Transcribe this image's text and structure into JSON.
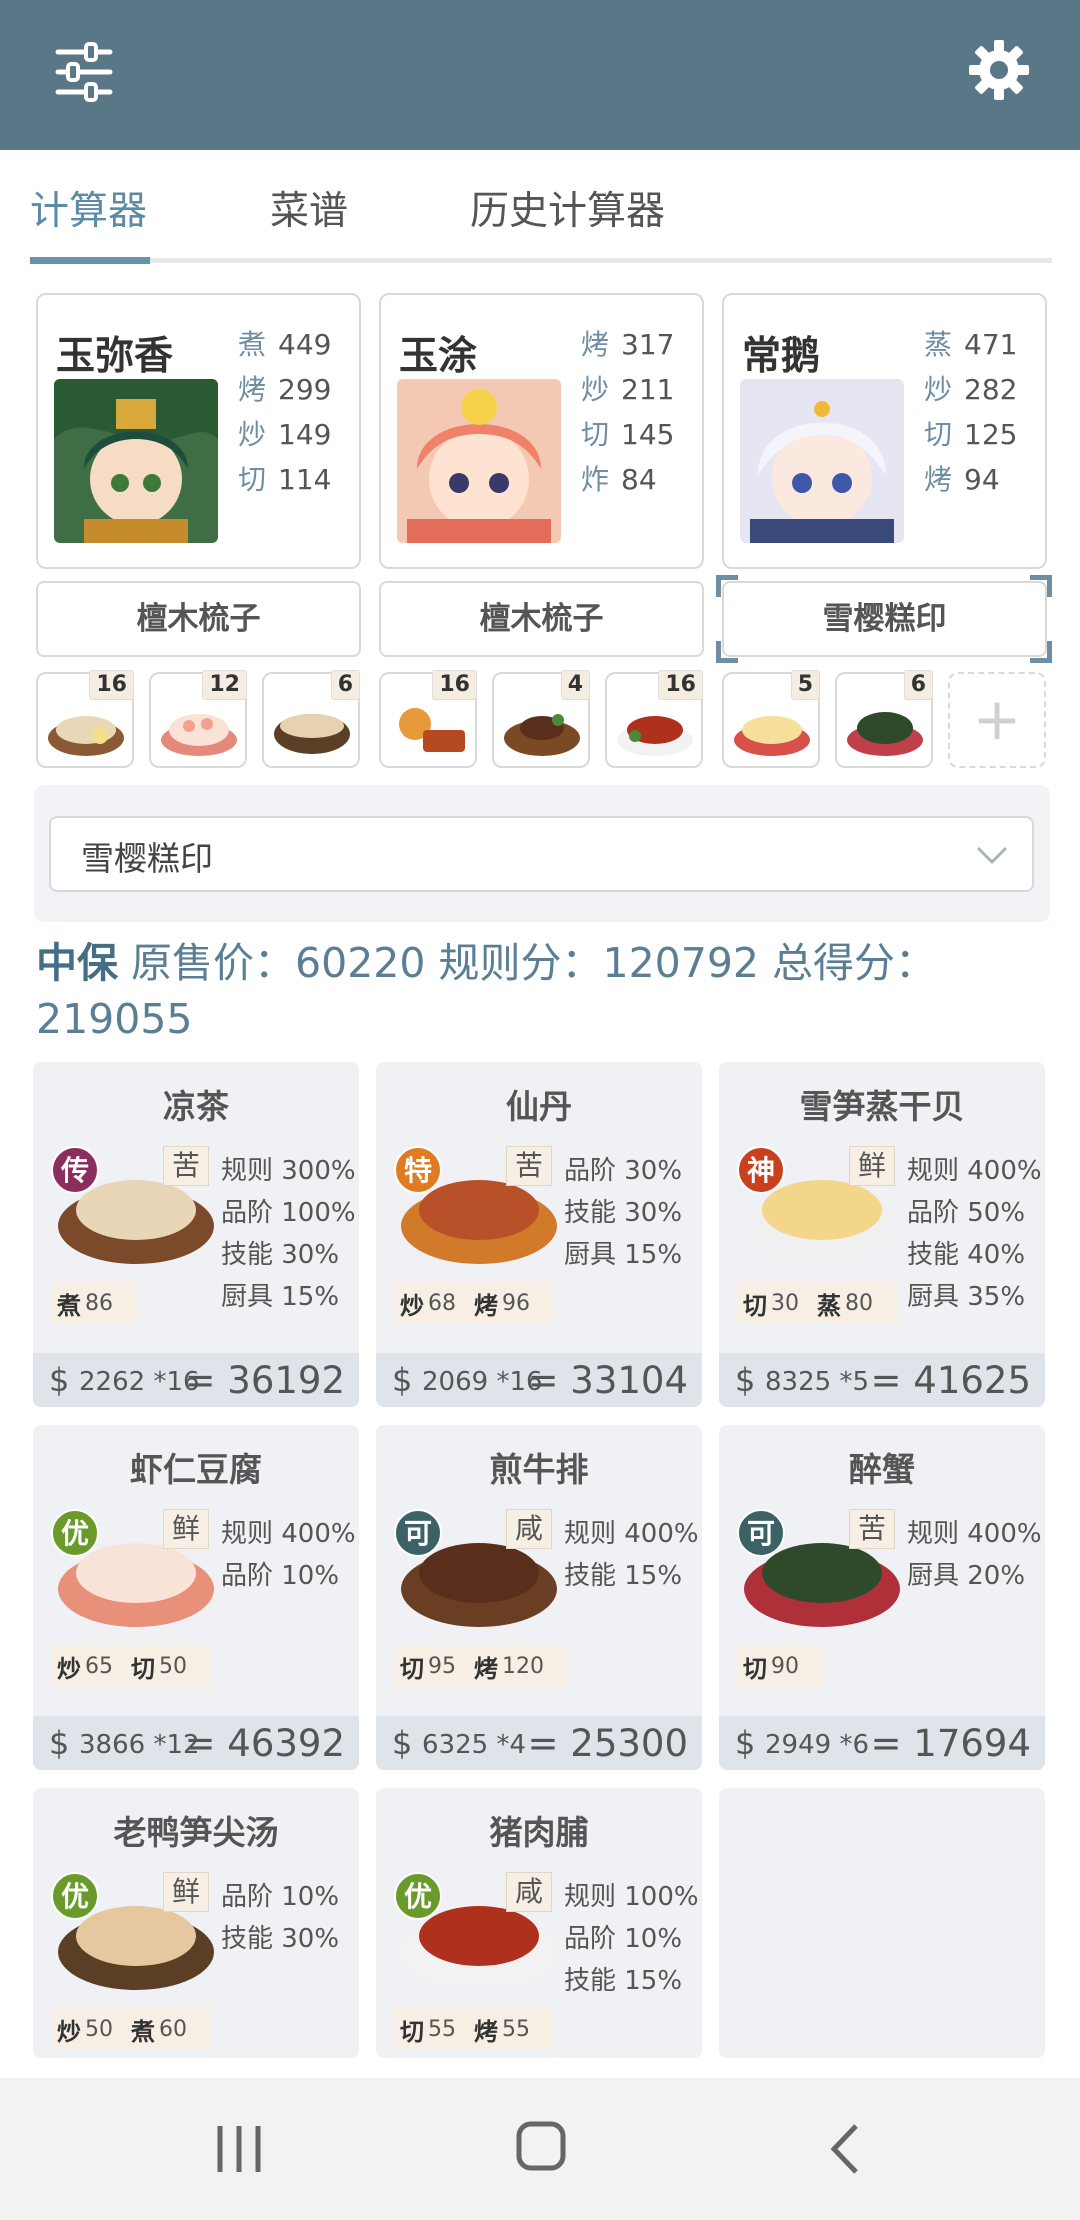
{
  "tabs": [
    "计算器",
    "菜谱",
    "历史计算器"
  ],
  "chefs": [
    {
      "name": "玉弥香",
      "stats": [
        {
          "k": "煮",
          "v": "449"
        },
        {
          "k": "烤",
          "v": "299"
        },
        {
          "k": "炒",
          "v": "149"
        },
        {
          "k": "切",
          "v": "114"
        }
      ],
      "equip": "檀木梳子"
    },
    {
      "name": "玉涂",
      "stats": [
        {
          "k": "烤",
          "v": "317"
        },
        {
          "k": "炒",
          "v": "211"
        },
        {
          "k": "切",
          "v": "145"
        },
        {
          "k": "炸",
          "v": "84"
        }
      ],
      "equip": "檀木梳子"
    },
    {
      "name": "常鹅",
      "stats": [
        {
          "k": "蒸",
          "v": "471"
        },
        {
          "k": "炒",
          "v": "282"
        },
        {
          "k": "切",
          "v": "125"
        },
        {
          "k": "烤",
          "v": "94"
        }
      ],
      "equip": "雪樱糕印"
    }
  ],
  "slots": [
    "16",
    "12",
    "6",
    "16",
    "4",
    "16",
    "5",
    "6"
  ],
  "add_slot": "+",
  "select_value": "雪樱糕印",
  "summary": {
    "tag": "中保",
    "text": " 原售价：60220 规则分：120792 总得分：219055"
  },
  "dishes": [
    {
      "title": "凉茶",
      "grade": "传",
      "grade_color": "#8b2d5e",
      "taste": "苦",
      "skills": [
        {
          "k": "煮",
          "v": "86"
        }
      ],
      "bonus": [
        "规则 300%",
        "品阶 100%",
        "技能 30%",
        "厨具 15%"
      ],
      "price": "2262",
      "mult": "*16",
      "result": "= 36192"
    },
    {
      "title": "仙丹",
      "grade": "特",
      "grade_color": "#e07b1f",
      "taste": "苦",
      "skills": [
        {
          "k": "炒",
          "v": "68"
        },
        {
          "k": "烤",
          "v": "96"
        }
      ],
      "bonus": [
        "品阶 30%",
        "技能 30%",
        "厨具 15%"
      ],
      "price": "2069",
      "mult": "*16",
      "result": "= 33104"
    },
    {
      "title": "雪笋蒸干贝",
      "grade": "神",
      "grade_color": "#c8401e",
      "taste": "鲜",
      "skills": [
        {
          "k": "切",
          "v": "30"
        },
        {
          "k": "蒸",
          "v": "80"
        }
      ],
      "bonus": [
        "规则 400%",
        "品阶 50%",
        "技能 40%",
        "厨具 35%"
      ],
      "price": "8325",
      "mult": "*5",
      "result": "= 41625"
    },
    {
      "title": "虾仁豆腐",
      "grade": "优",
      "grade_color": "#6a9a2a",
      "taste": "鲜",
      "skills": [
        {
          "k": "炒",
          "v": "65"
        },
        {
          "k": "切",
          "v": "50"
        }
      ],
      "bonus": [
        "规则 400%",
        "品阶 10%"
      ],
      "price": "3866",
      "mult": "*12",
      "result": "= 46392"
    },
    {
      "title": "煎牛排",
      "grade": "可",
      "grade_color": "#3c6266",
      "taste": "咸",
      "skills": [
        {
          "k": "切",
          "v": "95"
        },
        {
          "k": "烤",
          "v": "120"
        }
      ],
      "bonus": [
        "规则 400%",
        "技能 15%"
      ],
      "price": "6325",
      "mult": "*4",
      "result": "= 25300"
    },
    {
      "title": "醉蟹",
      "grade": "可",
      "grade_color": "#3c6266",
      "taste": "苦",
      "skills": [
        {
          "k": "切",
          "v": "90"
        }
      ],
      "bonus": [
        "规则 400%",
        "厨具 20%"
      ],
      "price": "2949",
      "mult": "*6",
      "result": "= 17694"
    },
    {
      "title": "老鸭笋尖汤",
      "grade": "优",
      "grade_color": "#6a9a2a",
      "taste": "鲜",
      "skills": [
        {
          "k": "炒",
          "v": "50"
        },
        {
          "k": "煮",
          "v": "60"
        }
      ],
      "bonus": [
        "品阶 10%",
        "技能 30%"
      ],
      "price": "",
      "mult": "",
      "result": ""
    },
    {
      "title": "猪肉脯",
      "grade": "优",
      "grade_color": "#6a9a2a",
      "taste": "咸",
      "skills": [
        {
          "k": "切",
          "v": "55"
        },
        {
          "k": "烤",
          "v": "55"
        }
      ],
      "bonus": [
        "规则 100%",
        "品阶 10%",
        "技能 15%"
      ],
      "price": "",
      "mult": "",
      "result": ""
    }
  ],
  "currency": "$",
  "icons": {
    "menu": "sliders-icon",
    "settings": "gear-icon",
    "dropdown": "chevron-down-icon",
    "nav": [
      "recent-apps-icon",
      "home-icon",
      "back-icon"
    ]
  }
}
